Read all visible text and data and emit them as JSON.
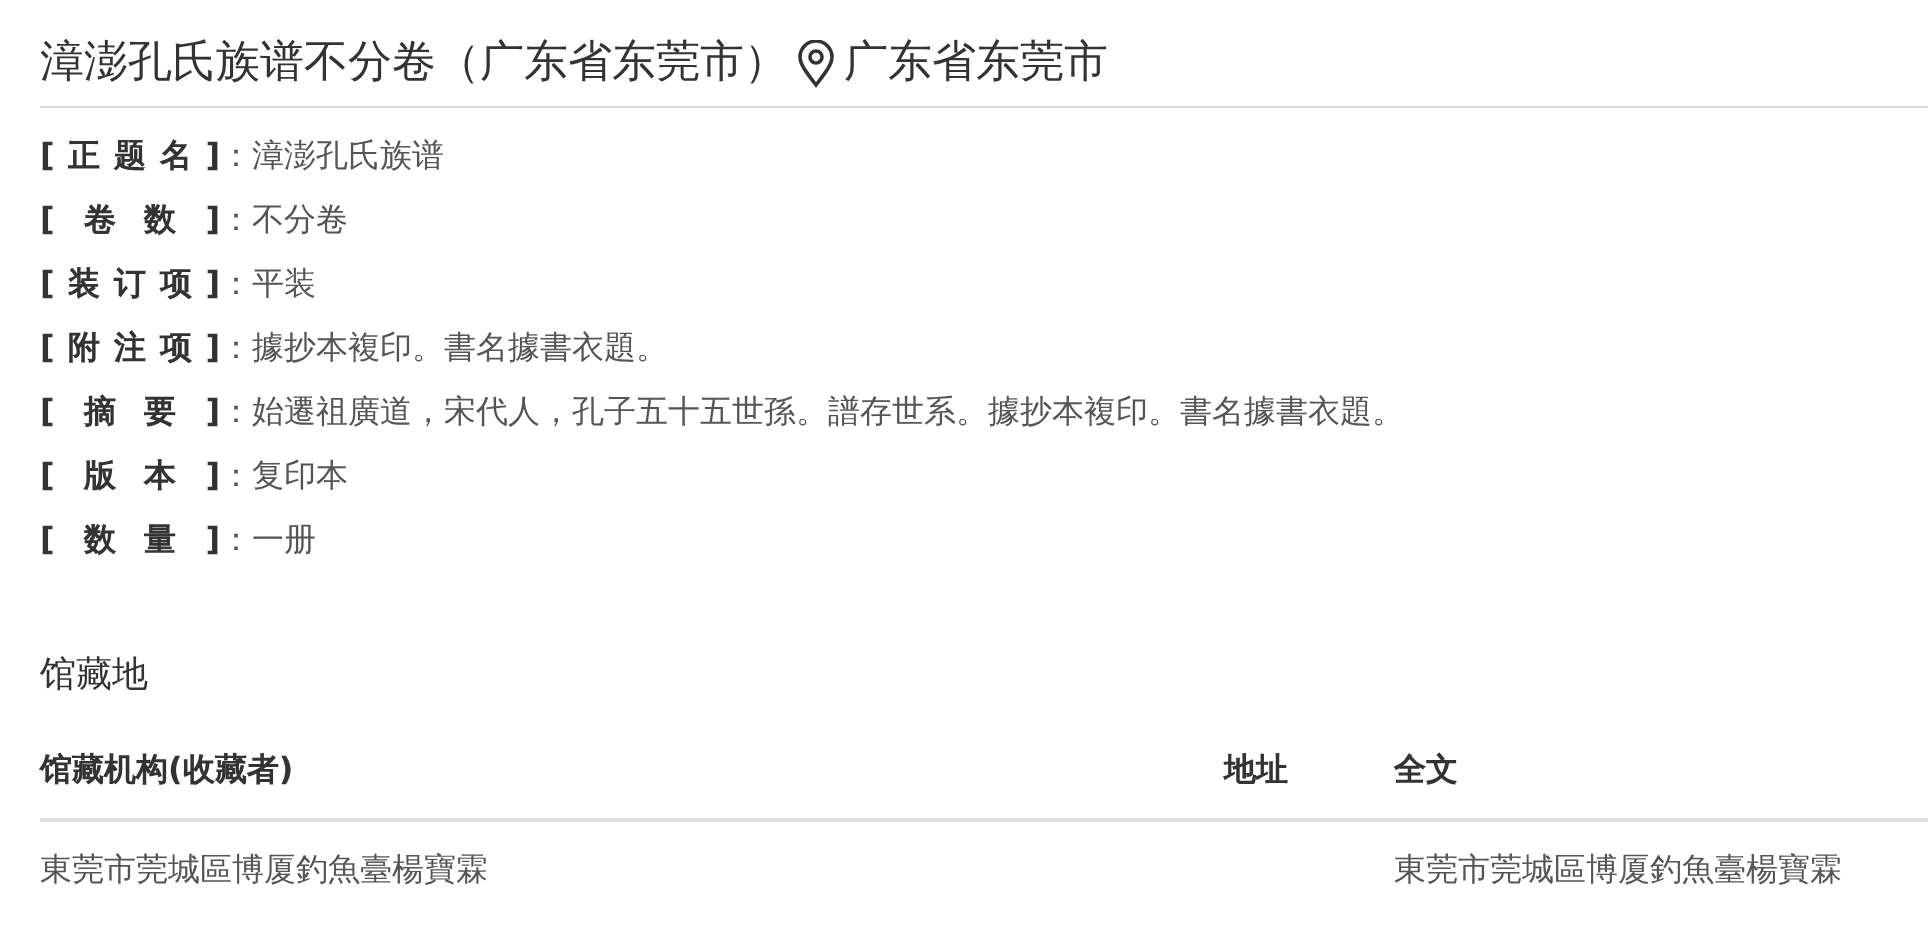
{
  "title": {
    "text": "漳澎孔氏族谱不分卷（广东省东莞市）",
    "location": "广东省东莞市"
  },
  "fields": [
    {
      "label": "[正题名]",
      "value": "：漳澎孔氏族谱"
    },
    {
      "label": "[卷数]",
      "value": "：不分卷"
    },
    {
      "label": "[装订项]",
      "value": "：平装"
    },
    {
      "label": "[附注项]",
      "value": "：據抄本複印。書名據書衣題。"
    },
    {
      "label": "[摘要]",
      "value": "：始遷祖廣道，宋代人，孔子五十五世孫。譜存世系。據抄本複印。書名據書衣題。"
    },
    {
      "label": "[版本]",
      "value": "：复印本"
    },
    {
      "label": "[数量]",
      "value": "：一册"
    }
  ],
  "holdings": {
    "heading": "馆藏地",
    "columns": [
      "馆藏机构(收藏者)",
      "地址",
      "全文"
    ],
    "rows": [
      [
        "東莞市莞城區博厦釣魚臺楊寶霖",
        "",
        "東莞市莞城區博厦釣魚臺楊寶霖"
      ]
    ]
  }
}
